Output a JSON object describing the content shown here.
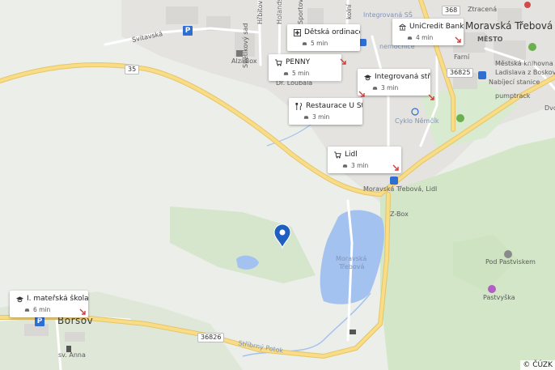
{
  "map": {
    "copyright": "© ČÚZK",
    "route_shields": [
      "35",
      "35",
      "368",
      "36825",
      "36826"
    ],
    "place_labels": {
      "svitavska": "Svitavská",
      "alzabox": "AlzaBox",
      "svetlkovy_sad": "Světlkový sad",
      "dr_loubala": "Dr. Loubala",
      "integrovana_ss": "Integrovaná SŠ",
      "ztracena": "Ztracená",
      "mesto": "MĚSTO",
      "moravska_trebova_town": "Moravská Třebová",
      "farni": "Farní",
      "nemocnice": "nemocnice",
      "knihovna1": "Městská knihovna",
      "knihovna2": "Ladislava z Boskovic",
      "nabijeci": "Nabíjecí stanice",
      "pumptrack": "pumptrack",
      "cyklo": "Cyklo Němčík",
      "lidl_stop": "Moravská Třebová, Lidl",
      "zbox": "Z-Box",
      "lake1": "Moravská",
      "lake2": "Třebová",
      "pod_pastviskem": "Pod Pastviskem",
      "pastvyska": "Pastvyška",
      "borsov": "Boršov",
      "sv_anna": "sv. Anna",
      "stribrny_potok": "Stříbrný Potok",
      "hrbitov": "Hřbitov",
      "sportovni": "Sportovní",
      "kolni": "kolní",
      "holandska": "Holandská",
      "dvor": "Dvo"
    },
    "colors": {
      "land": "#eceee9",
      "forest": "#cfe4c4",
      "water": "#a4c2f0",
      "road_major": "#f6d77c",
      "road_minor": "#ffffff",
      "marker": "#1f5fbf"
    }
  },
  "pois": [
    {
      "name": "Dětská ordinace ...",
      "time": "5 min",
      "icon": "hospital-icon"
    },
    {
      "name": "UniCredit Bank",
      "time": "4 min",
      "icon": "bank-icon"
    },
    {
      "name": "PENNY",
      "time": "5 min",
      "icon": "cart-icon"
    },
    {
      "name": "Integrovaná střed...",
      "time": "3 min",
      "icon": "school-icon"
    },
    {
      "name": "Restaurace U Štiky",
      "time": "3 min",
      "icon": "restaurant-icon"
    },
    {
      "name": "Lidl",
      "time": "3 min",
      "icon": "cart-icon"
    },
    {
      "name": "I. mateřská škola ...",
      "time": "6 min",
      "icon": "school-icon"
    }
  ],
  "parking_label": "P"
}
